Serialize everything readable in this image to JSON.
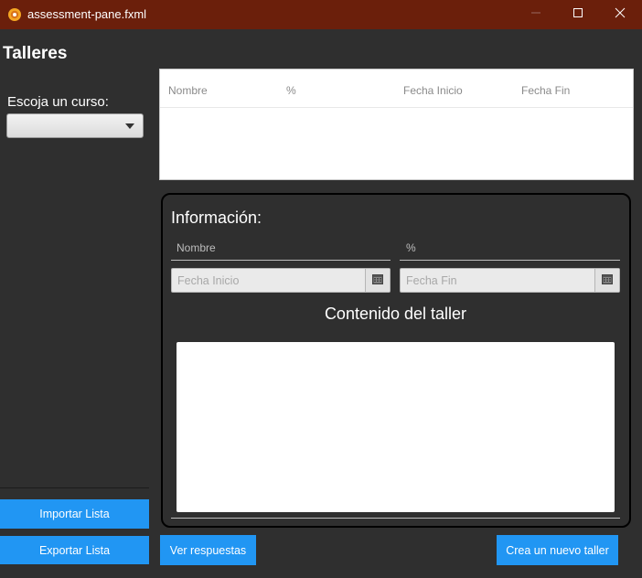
{
  "window": {
    "title": "assessment-pane.fxml",
    "icon": "gear-app-icon",
    "controls": [
      "minimize-icon",
      "maximize-icon",
      "close-icon"
    ]
  },
  "left_panel": {
    "title": "Talleres",
    "course_label": "Escoja un curso:",
    "course_selected": "",
    "import_button": "Importar Lista",
    "export_button": "Exportar Lista"
  },
  "table": {
    "columns": [
      "Nombre",
      "%",
      "Fecha Inicio",
      "Fecha Fin"
    ],
    "rows": []
  },
  "info": {
    "title": "Información:",
    "name_placeholder": "Nombre",
    "percent_placeholder": "%",
    "start_date_placeholder": "Fecha Inicio",
    "end_date_placeholder": "Fecha Fin",
    "content_title": "Contenido del taller",
    "content_value": ""
  },
  "actions": {
    "view_answers_button": "Ver respuestas",
    "create_button": "Crea un nuevo taller"
  },
  "colors": {
    "titlebar": "#6b1f0b",
    "background": "#2f2f2f",
    "accent": "#2196f3"
  }
}
